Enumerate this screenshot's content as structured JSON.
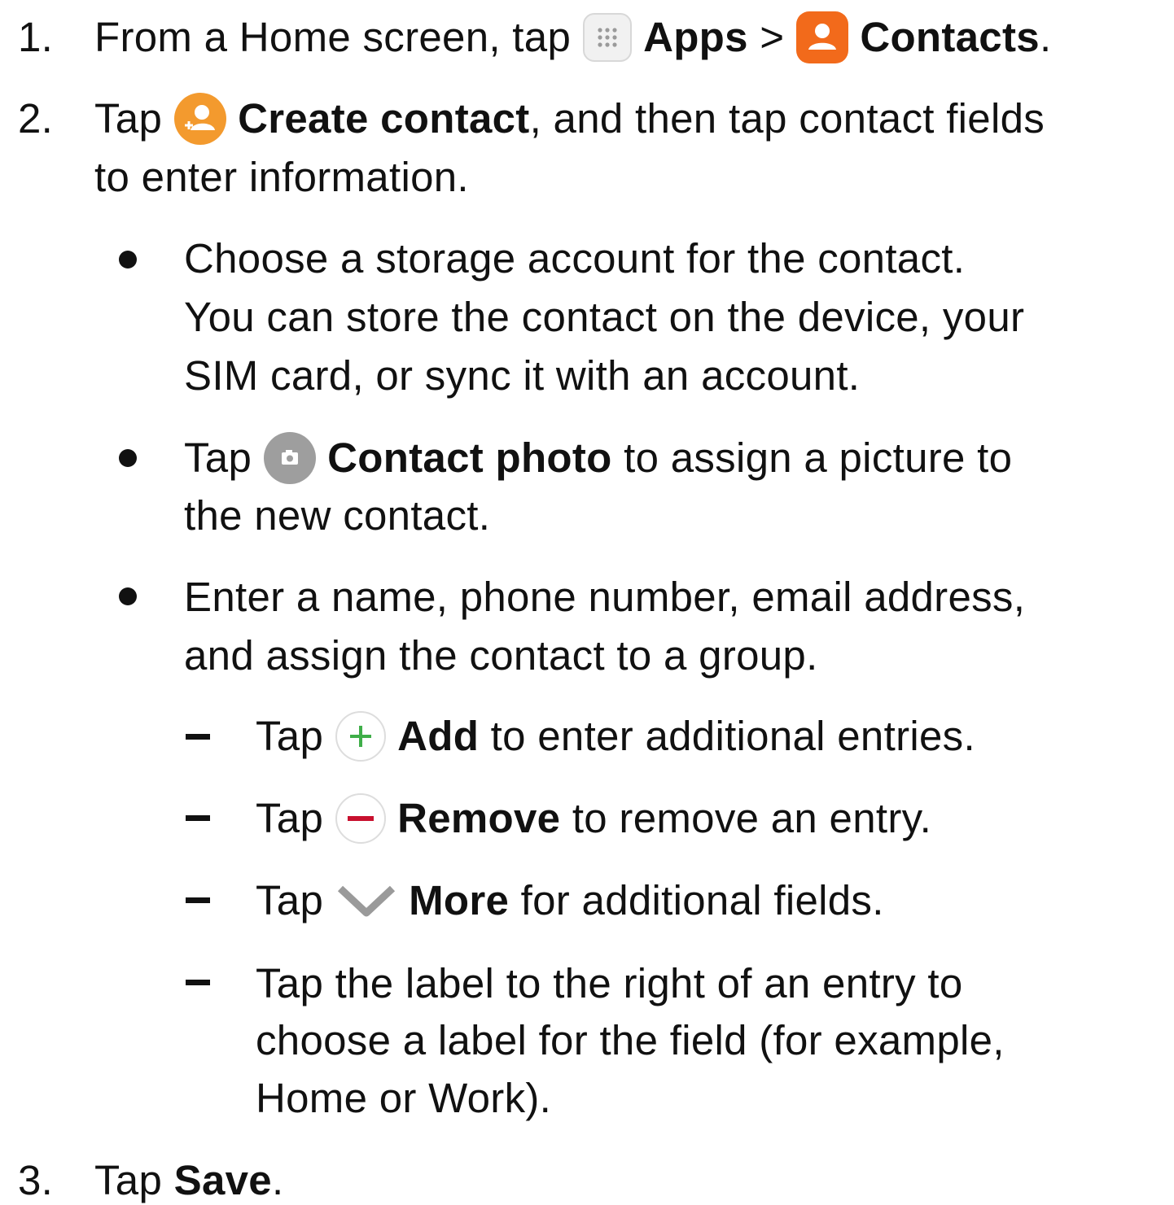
{
  "steps": [
    {
      "number": "1.",
      "lead": "From a Home screen, tap",
      "apps_label": "Apps",
      "separator": ">",
      "contacts_label": "Contacts",
      "end": "."
    },
    {
      "number": "2.",
      "lead": "Tap",
      "create_label": "Create contact",
      "rest_line1": ", and then tap contact fields",
      "rest_line2": "to enter information."
    },
    {
      "number": "3.",
      "lead": "Tap",
      "save_label": "Save",
      "end": "."
    }
  ],
  "bullets": {
    "storage": {
      "line1": "Choose a storage account for the contact.",
      "line2": "You can store the contact on the device, your",
      "line3": "SIM card, or sync it with an account."
    },
    "photo": {
      "lead": "Tap",
      "label": "Contact photo",
      "rest_line1": "to assign a picture to",
      "rest_line2": "the new contact."
    },
    "enter": {
      "line1": "Enter a name, phone number, email address,",
      "line2": "and assign the contact to a group."
    }
  },
  "subitems": {
    "add": {
      "lead": "Tap",
      "label": "Add",
      "rest": "to enter additional entries."
    },
    "remove": {
      "lead": "Tap",
      "label": "Remove",
      "rest": "to remove an entry."
    },
    "more": {
      "lead": "Tap",
      "label": "More",
      "rest": "for additional fields."
    },
    "label": {
      "line1": "Tap the label to the right of an entry to",
      "line2": "choose a label for the field (for example,",
      "line3": "Home or Work)."
    }
  },
  "icons": {
    "apps": "apps-grid-icon",
    "contacts": "contacts-app-icon",
    "create": "create-contact-icon",
    "camera": "camera-icon",
    "add": "plus-icon",
    "remove": "minus-icon",
    "more": "chevron-down-icon"
  },
  "colors": {
    "contacts_orange": "#f26a1b",
    "create_orange": "#f39a2e",
    "camera_gray": "#9e9e9e",
    "add_green": "#3fae49",
    "remove_red": "#c8102e",
    "chevron_gray": "#9a9a9a"
  }
}
